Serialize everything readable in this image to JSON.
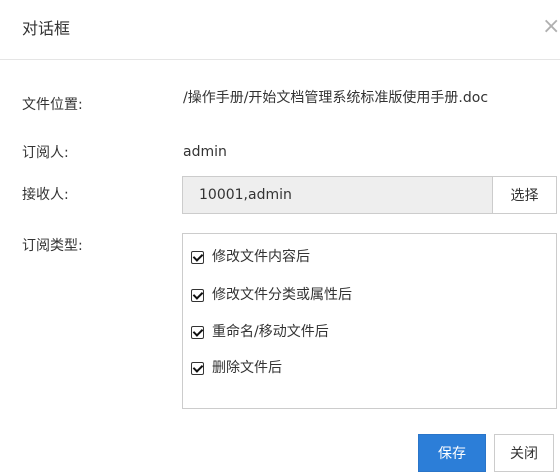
{
  "dialog": {
    "title": "对话框",
    "close_icon": "close-icon"
  },
  "form": {
    "file_location_label": "文件位置:",
    "file_location_value": "/操作手册/开始文档管理系统标准版使用手册.doc",
    "subscriber_label": "订阅人:",
    "subscriber_value": "admin",
    "recipients_label": "接收人:",
    "recipients_value": "10001,admin",
    "select_button": "选择",
    "subscription_type_label": "订阅类型:",
    "subscription_types": [
      {
        "label": "修改文件内容后",
        "checked": true
      },
      {
        "label": "修改文件分类或属性后",
        "checked": true
      },
      {
        "label": "重命名/移动文件后",
        "checked": true
      },
      {
        "label": "删除文件后",
        "checked": true
      }
    ]
  },
  "footer": {
    "save_label": "保存",
    "close_label": "关闭"
  },
  "colors": {
    "primary": "#2c7ed8",
    "input_readonly_bg": "#eeeeee"
  }
}
